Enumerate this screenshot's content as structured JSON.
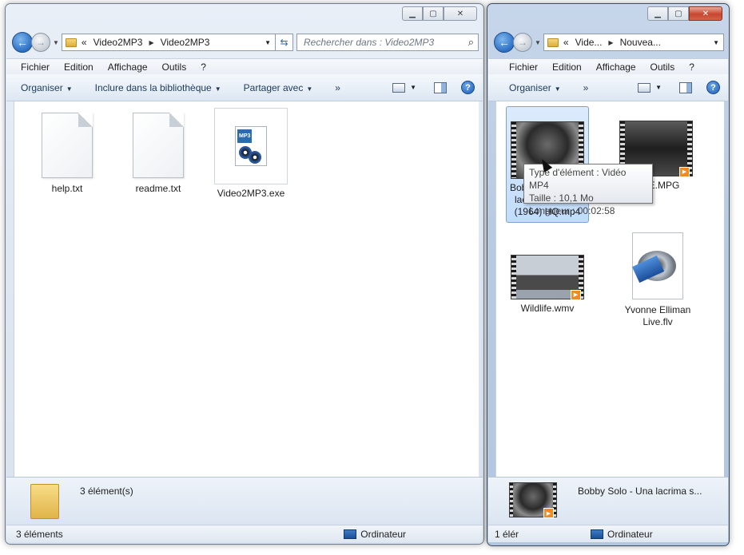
{
  "left_window": {
    "address": {
      "prefix": "«",
      "crumbs": [
        "Video2MP3",
        "Video2MP3"
      ]
    },
    "search_placeholder": "Rechercher dans : Video2MP3",
    "menu": [
      "Fichier",
      "Edition",
      "Affichage",
      "Outils",
      "?"
    ],
    "commands": [
      "Organiser",
      "Inclure dans la bibliothèque",
      "Partager avec",
      "»"
    ],
    "files": [
      {
        "name": "help.txt",
        "type": "txt"
      },
      {
        "name": "readme.txt",
        "type": "txt"
      },
      {
        "name": "Video2MP3.exe",
        "type": "exe"
      }
    ],
    "details": {
      "summary": "3 élément(s)"
    },
    "status": {
      "count": "3 éléments",
      "location": "Ordinateur"
    },
    "icon_label": "MP3"
  },
  "right_window": {
    "address": {
      "prefix": "«",
      "crumbs": [
        "Vide...",
        "Nouvea..."
      ]
    },
    "menu": [
      "Fichier",
      "Edition",
      "Affichage",
      "Outils",
      "?"
    ],
    "commands": [
      "Organiser",
      "»"
    ],
    "files": [
      {
        "name_lines": [
          "Bobby Solo - Una",
          "lacrima sul viso",
          "(1964) HQ.mp4"
        ],
        "type": "video"
      },
      {
        "name": "...ME.MPG",
        "type": "video"
      },
      {
        "name": "Wildlife.wmv",
        "type": "video"
      },
      {
        "name_lines": [
          "Yvonne Elliman",
          "Live.flv"
        ],
        "type": "flv"
      }
    ],
    "details": {
      "title": "Bobby Solo - Una lacrima s..."
    },
    "status": {
      "count": "1 élér",
      "location": "Ordinateur"
    }
  },
  "tooltip": {
    "type_line": "Type d'élément : Vidéo MP4",
    "size_line": "Taille : 10,1 Mo",
    "length_line": "Longueur : 00:02:58"
  },
  "colors": {
    "accent": "#2b6cb0",
    "selection": "#c1dcfc",
    "play_badge": "#f08a23"
  }
}
